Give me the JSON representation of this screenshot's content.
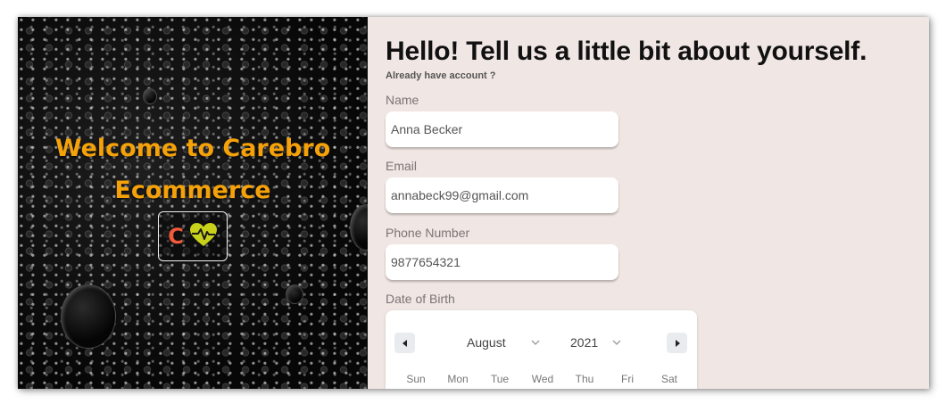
{
  "brand": {
    "welcome_line1": "Welcome to Carebro",
    "welcome_line2": "Ecommerce",
    "logo_letter": "C",
    "colors": {
      "welcome": "#f5a20a",
      "logo_letter": "#f15a3a",
      "logo_heart": "#c9d21a"
    }
  },
  "form": {
    "title": "Hello! Tell us a little bit about yourself.",
    "already_have_account": "Already have account ?",
    "name_label": "Name",
    "name_value": "Anna Becker",
    "email_label": "Email",
    "email_value": "annabeck99@gmail.com",
    "phone_label": "Phone Number",
    "phone_value": "9877654321",
    "dob_label": "Date of Birth"
  },
  "calendar": {
    "month": "August",
    "year": "2021",
    "prev_icon": "chevron-left-icon",
    "next_icon": "chevron-right-icon",
    "weekdays": [
      "Sun",
      "Mon",
      "Tue",
      "Wed",
      "Thu",
      "Fri",
      "Sat"
    ]
  },
  "colors": {
    "panel_background": "#f0e6e3",
    "input_background": "#ffffff"
  }
}
